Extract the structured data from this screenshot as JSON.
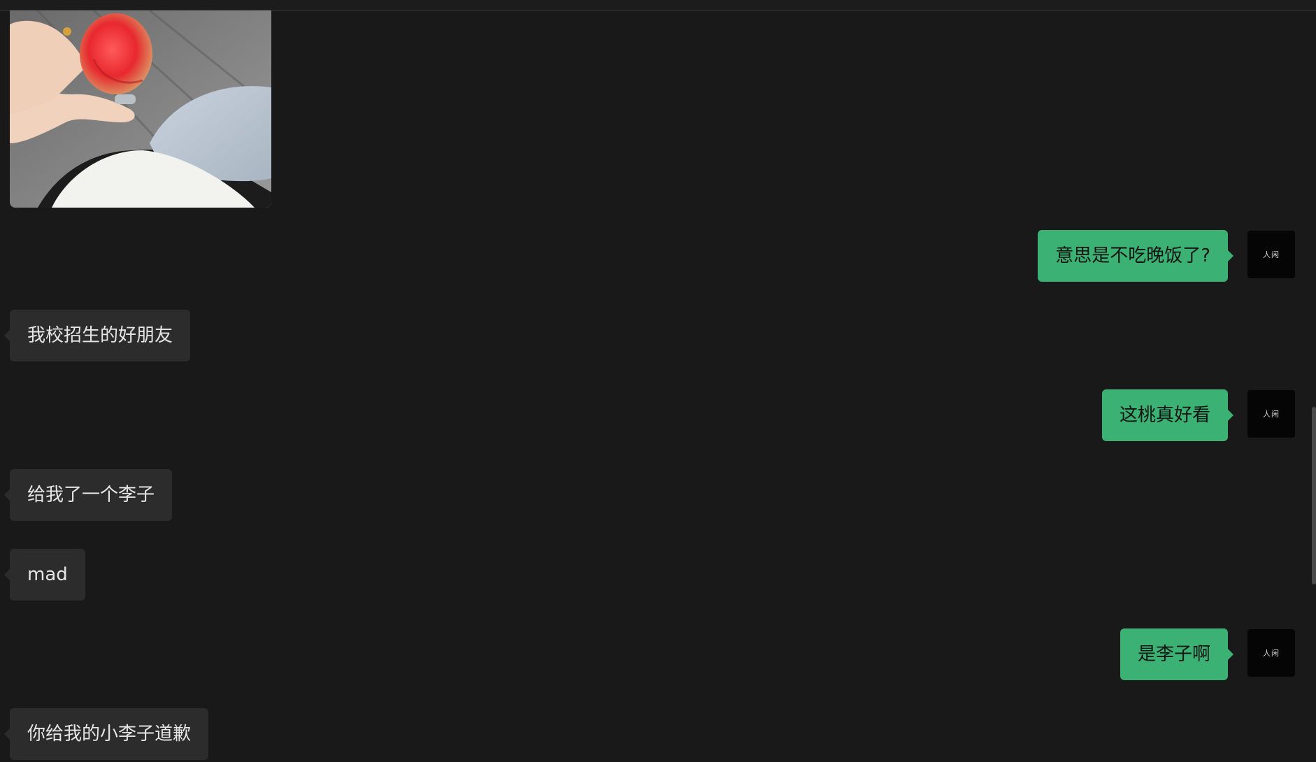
{
  "conversation": {
    "messages": [
      {
        "side": "in",
        "type": "image",
        "alt": ""
      },
      {
        "side": "out",
        "type": "text",
        "text": "意思是不吃晚饭了?",
        "avatar": "人闲"
      },
      {
        "side": "in",
        "type": "text",
        "text": "我校招生的好朋友"
      },
      {
        "side": "out",
        "type": "text",
        "text": "这桃真好看",
        "avatar": "人闲"
      },
      {
        "side": "in",
        "type": "text",
        "text": "给我了一个李子"
      },
      {
        "side": "in",
        "type": "text",
        "text": "mad"
      },
      {
        "side": "out",
        "type": "text",
        "text": "是李子啊",
        "avatar": "人闲"
      },
      {
        "side": "in",
        "type": "text",
        "text": "你给我的小李子道歉"
      }
    ]
  },
  "colors": {
    "background": "#191919",
    "incoming_bubble": "#2c2c2c",
    "outgoing_bubble": "#3bb273",
    "avatar_background": "#050505"
  }
}
